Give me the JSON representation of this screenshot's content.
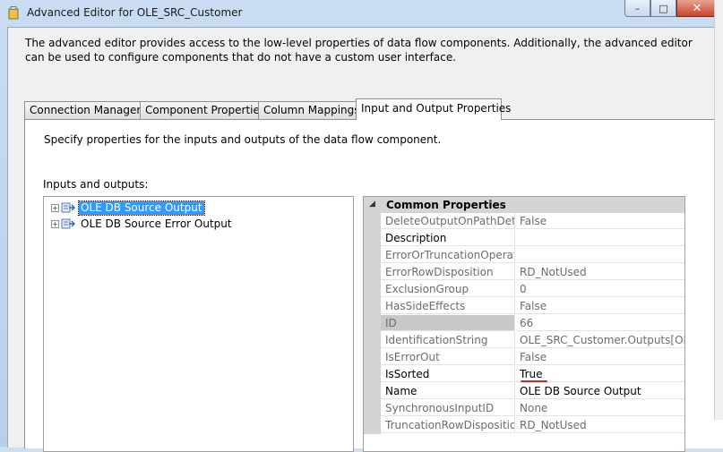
{
  "window": {
    "title": "Advanced Editor for OLE_SRC_Customer",
    "minimize": "–",
    "maximize": "□",
    "close": "✕"
  },
  "intro_text": "The advanced editor provides access to the low-level properties of data flow components. Additionally, the advanced editor can be used to configure components that do not have a custom user interface.",
  "tabs": [
    {
      "label": "Connection Managers",
      "active": false
    },
    {
      "label": "Component Properties",
      "active": false
    },
    {
      "label": "Column Mappings",
      "active": false
    },
    {
      "label": "Input and Output Properties",
      "active": true
    }
  ],
  "panel": {
    "description": "Specify properties for the inputs and outputs of the data flow component.",
    "io_label": "Inputs and outputs:"
  },
  "tree": [
    {
      "label": "OLE DB Source Output",
      "selected": true,
      "expander": "+"
    },
    {
      "label": "OLE DB Source Error Output",
      "selected": false,
      "expander": "+"
    }
  ],
  "properties": {
    "category": "Common Properties",
    "category_toggle": "◢",
    "rows": [
      {
        "name": "DeleteOutputOnPathDetached",
        "value": "False",
        "enabled": false
      },
      {
        "name": "Description",
        "value": "",
        "enabled": true
      },
      {
        "name": "ErrorOrTruncationOperation",
        "value": "",
        "enabled": false
      },
      {
        "name": "ErrorRowDisposition",
        "value": "RD_NotUsed",
        "enabled": false
      },
      {
        "name": "ExclusionGroup",
        "value": "0",
        "enabled": false
      },
      {
        "name": "HasSideEffects",
        "value": "False",
        "enabled": false
      },
      {
        "name": "ID",
        "value": "66",
        "enabled": false
      },
      {
        "name": "IdentificationString",
        "value": "OLE_SRC_Customer.Outputs[OLE DB Source Output]",
        "enabled": false
      },
      {
        "name": "IsErrorOut",
        "value": "False",
        "enabled": false
      },
      {
        "name": "IsSorted",
        "value": "True",
        "enabled": true
      },
      {
        "name": "Name",
        "value": "OLE DB Source Output",
        "enabled": true
      },
      {
        "name": "SynchronousInputID",
        "value": "None",
        "enabled": false
      },
      {
        "name": "TruncationRowDisposition",
        "value": "RD_NotUsed",
        "enabled": false
      }
    ]
  },
  "colors": {
    "selection": "#3399ff",
    "annotation_underline": "#e0201a"
  }
}
